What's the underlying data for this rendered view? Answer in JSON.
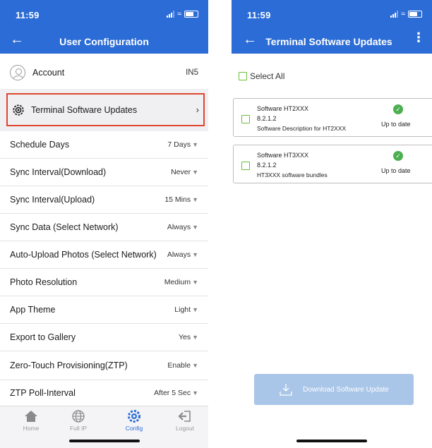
{
  "left": {
    "status_time": "11:59",
    "title": "User Configuration",
    "account": {
      "label": "Account",
      "value": "IN5"
    },
    "terminal_updates_label": "Terminal Software Updates",
    "settings": [
      {
        "label": "Schedule Days",
        "value": "7 Days"
      },
      {
        "label": "Sync Interval(Download)",
        "value": "Never"
      },
      {
        "label": "Sync Interval(Upload)",
        "value": "15 Mins"
      },
      {
        "label": "Sync Data (Select Network)",
        "value": "Always"
      },
      {
        "label": "Auto-Upload Photos (Select Network)",
        "value": "Always"
      },
      {
        "label": "Photo Resolution",
        "value": "Medium"
      },
      {
        "label": "App Theme",
        "value": "Light"
      },
      {
        "label": "Export to Gallery",
        "value": "Yes"
      },
      {
        "label": "Zero-Touch Provisioning(ZTP)",
        "value": "Enable"
      },
      {
        "label": "ZTP Poll-Interval",
        "value": "After 5 Sec"
      }
    ],
    "tabs": [
      {
        "label": "Home",
        "icon": "home-icon"
      },
      {
        "label": "Full IP",
        "icon": "globe-icon"
      },
      {
        "label": "Config",
        "icon": "gear-icon"
      },
      {
        "label": "Logout",
        "icon": "logout-icon"
      }
    ]
  },
  "right": {
    "status_time": "11:59",
    "title": "Terminal Software Updates",
    "select_all_label": "Select All",
    "packages": [
      {
        "name": "Software HT2XXX",
        "version": "8.2.1.2",
        "description": "Software Description for HT2XXX",
        "status": "Up to date"
      },
      {
        "name": "Software HT3XXX",
        "version": "8.2.1.2",
        "description": "HT3XXX software bundles",
        "status": "Up to date"
      }
    ],
    "download_button_label": "Download Software Update"
  },
  "colors": {
    "header_blue": "#2c6cd6",
    "highlight_red": "#e0452f",
    "checkbox_green": "#6cbf3a",
    "status_ok_green": "#4caf50",
    "disabled_button": "#a9c5e8"
  }
}
